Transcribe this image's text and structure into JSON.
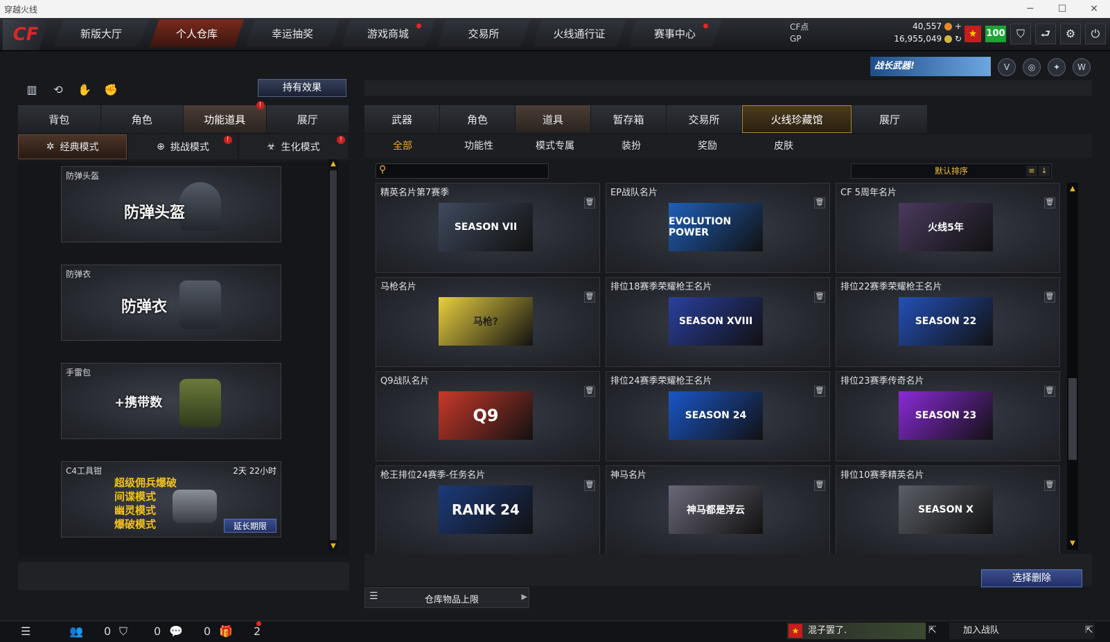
{
  "window": {
    "title": "穿越火线"
  },
  "nav": {
    "logo": "CF",
    "tabs": [
      {
        "label": "新版大厅"
      },
      {
        "label": "个人仓库"
      },
      {
        "label": "幸运抽奖"
      },
      {
        "label": "游戏商城"
      },
      {
        "label": "交易所"
      },
      {
        "label": "火线通行证"
      },
      {
        "label": "赛事中心"
      }
    ],
    "active_index": 1
  },
  "currency": {
    "cf_label": "CF点",
    "cf_value": "40,557",
    "gp_label": "GP",
    "gp_value": "16,955,049"
  },
  "player": {
    "level": "100"
  },
  "banner": {
    "text": "战长武器!"
  },
  "left": {
    "effect_button": "持有效果",
    "tabs": [
      "背包",
      "角色",
      "功能道具",
      "展厅"
    ],
    "modes": [
      "经典模式",
      "挑战模式",
      "生化模式"
    ],
    "items": [
      {
        "caption": "防弹头盔",
        "big": "防弹头盔"
      },
      {
        "caption": "防弹衣",
        "big": "防弹衣"
      },
      {
        "caption": "手雷包",
        "big": "+携带数"
      },
      {
        "caption": "C4工具钳",
        "time": "2天 22小时",
        "modes": [
          "超级佣兵爆破",
          "间谍模式",
          "幽灵模式",
          "爆破模式"
        ],
        "extend": "延长期限"
      }
    ]
  },
  "right": {
    "tabs": [
      "武器",
      "角色",
      "道具",
      "暂存箱",
      "交易所",
      "火线珍藏馆",
      "展厅"
    ],
    "subtabs": [
      "全部",
      "功能性",
      "模式专属",
      "装扮",
      "奖励",
      "皮肤"
    ],
    "sort_label": "默认排序",
    "cards": [
      {
        "title": "精英名片第7赛季",
        "img": "SEASON VII",
        "bg": "#3f4a5e"
      },
      {
        "title": "EP战队名片",
        "img": "EVOLUTION POWER",
        "bg": "#1e5fb8"
      },
      {
        "title": "CF 5周年名片",
        "img": "火线5年",
        "bg": "#4a3a5e"
      },
      {
        "title": "马枪名片",
        "img": "马枪?",
        "bg": "#e8d040"
      },
      {
        "title": "排位18赛季荣耀枪王名片",
        "img": "SEASON XVIII",
        "bg": "#2a3f9e"
      },
      {
        "title": "排位22赛季荣耀枪王名片",
        "img": "SEASON 22",
        "bg": "#2450b8"
      },
      {
        "title": "Q9战队名片",
        "img": "Q9",
        "bg": "#c8382a"
      },
      {
        "title": "排位24赛季荣耀枪王名片",
        "img": "SEASON 24",
        "bg": "#1a56c8"
      },
      {
        "title": "排位23赛季传奇名片",
        "img": "SEASON 23",
        "bg": "#8a2ad8"
      },
      {
        "title": "枪王排位24赛季-任务名片",
        "img": "RANK 24",
        "bg": "#1c3a7a"
      },
      {
        "title": "神马名片",
        "img": "神马都是浮云",
        "bg": "#6a6878"
      },
      {
        "title": "排位10赛季精英名片",
        "img": "SEASON X",
        "bg": "#5a5e66"
      }
    ],
    "delete_button": "选择删除",
    "capacity_label": "仓库物品上限"
  },
  "bottom": {
    "counts": [
      "0",
      "0",
      "0",
      "2"
    ],
    "chat_text": "混子罢了.",
    "join_team": "加入战队"
  }
}
